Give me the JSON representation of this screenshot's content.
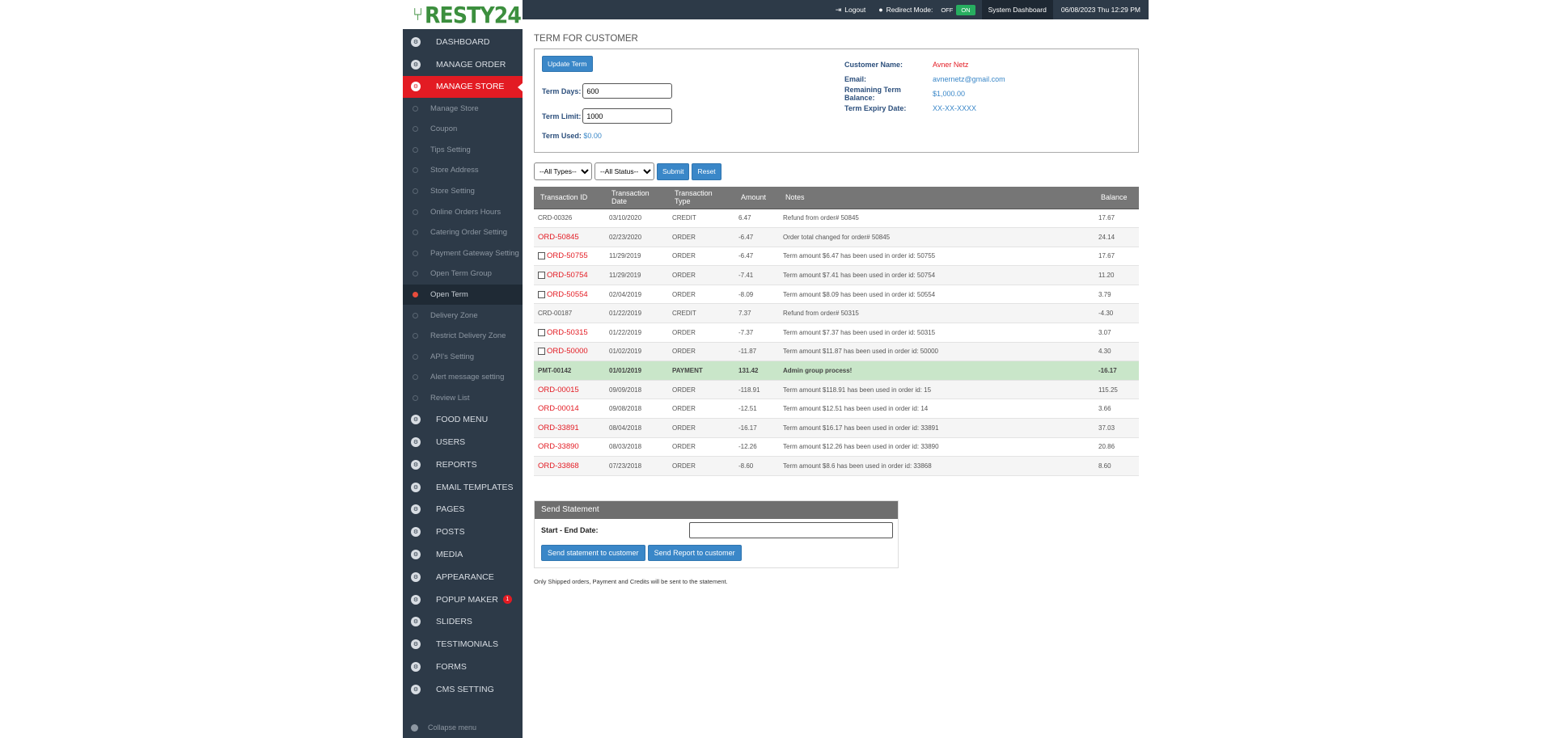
{
  "brand": {
    "name": "RESTY24"
  },
  "sidebar": {
    "main_items_top": [
      {
        "label": "DASHBOARD",
        "icon": "dashboard-icon"
      },
      {
        "label": "MANAGE ORDER",
        "icon": "gear-icon"
      },
      {
        "label": "MANAGE STORE",
        "icon": "gear-icon",
        "active": true
      }
    ],
    "sub_items": [
      {
        "label": "Manage Store"
      },
      {
        "label": "Coupon"
      },
      {
        "label": "Tips Setting"
      },
      {
        "label": "Store Address"
      },
      {
        "label": "Store Setting"
      },
      {
        "label": "Online Orders Hours"
      },
      {
        "label": "Catering Order Setting"
      },
      {
        "label": "Payment Gateway Setting"
      },
      {
        "label": "Open Term Group"
      },
      {
        "label": "Open Term",
        "active": true
      },
      {
        "label": "Delivery Zone"
      },
      {
        "label": "Restrict Delivery Zone"
      },
      {
        "label": "API's Setting"
      },
      {
        "label": "Alert message setting"
      },
      {
        "label": "Review List"
      }
    ],
    "main_items_bottom": [
      {
        "label": "FOOD MENU",
        "icon": "gear-icon"
      },
      {
        "label": "USERS",
        "icon": "user-icon"
      },
      {
        "label": "REPORTS",
        "icon": "gear-icon"
      },
      {
        "label": "EMAIL TEMPLATES",
        "icon": "gear-icon"
      },
      {
        "label": "PAGES",
        "icon": "page-icon"
      },
      {
        "label": "POSTS",
        "icon": "pin-icon"
      },
      {
        "label": "MEDIA",
        "icon": "media-icon"
      },
      {
        "label": "APPEARANCE",
        "icon": "brush-icon"
      },
      {
        "label": "POPUP MAKER",
        "icon": "popup-icon",
        "badge": "1"
      },
      {
        "label": "SLIDERS",
        "icon": "slider-icon"
      },
      {
        "label": "TESTIMONIALS",
        "icon": "quote-icon"
      },
      {
        "label": "FORMS",
        "icon": "form-icon"
      },
      {
        "label": "CMS SETTING",
        "icon": "gear-icon"
      }
    ],
    "collapse_label": "Collapse menu"
  },
  "topbar": {
    "logout_label": "Logout",
    "redirect_label": "Redirect Mode:",
    "switch_off": "OFF",
    "switch_on": "ON",
    "dashboard_label": "System Dashboard",
    "datetime": "06/08/2023 Thu 12:29 PM"
  },
  "page": {
    "title": "TERM FOR CUSTOMER",
    "update_button": "Update Term",
    "term_days_label": "Term Days:",
    "term_days_value": "600",
    "term_limit_label": "Term Limit:",
    "term_limit_value": "1000",
    "term_used_label": "Term Used:",
    "term_used_value": "$0.00"
  },
  "customer": {
    "name_label": "Customer Name:",
    "name": "Avner Netz",
    "email_label": "Email:",
    "email": "avnernetz@gmail.com",
    "balance_label": "Remaining Term Balance:",
    "balance": "$1,000.00",
    "expiry_label": "Term Expiry Date:",
    "expiry": "XX-XX-XXXX"
  },
  "filters": {
    "types": "--All Types--",
    "status": "--All Status--",
    "submit": "Submit",
    "reset": "Reset"
  },
  "table": {
    "headers": [
      "Transaction ID",
      "Transaction Date",
      "Transaction Type",
      "Amount",
      "Notes",
      "Balance"
    ],
    "rows": [
      {
        "id": "CRD-00326",
        "link": false,
        "check": false,
        "date": "03/10/2020",
        "type": "CREDIT",
        "amount": "6.47",
        "notes": "Refund from order# 50845",
        "balance": "17.67"
      },
      {
        "id": "ORD-50845",
        "link": true,
        "check": false,
        "date": "02/23/2020",
        "type": "ORDER",
        "amount": "-6.47",
        "notes": "Order total changed for order# 50845",
        "balance": "24.14"
      },
      {
        "id": "ORD-50755",
        "link": true,
        "check": true,
        "date": "11/29/2019",
        "type": "ORDER",
        "amount": "-6.47",
        "notes": "Term amount $6.47 has been used in order id: 50755",
        "balance": "17.67"
      },
      {
        "id": "ORD-50754",
        "link": true,
        "check": true,
        "date": "11/29/2019",
        "type": "ORDER",
        "amount": "-7.41",
        "notes": "Term amount $7.41 has been used in order id: 50754",
        "balance": "11.20"
      },
      {
        "id": "ORD-50554",
        "link": true,
        "check": true,
        "date": "02/04/2019",
        "type": "ORDER",
        "amount": "-8.09",
        "notes": "Term amount $8.09 has been used in order id: 50554",
        "balance": "3.79"
      },
      {
        "id": "CRD-00187",
        "link": false,
        "check": false,
        "date": "01/22/2019",
        "type": "CREDIT",
        "amount": "7.37",
        "notes": "Refund from order# 50315",
        "balance": "-4.30"
      },
      {
        "id": "ORD-50315",
        "link": true,
        "check": true,
        "date": "01/22/2019",
        "type": "ORDER",
        "amount": "-7.37",
        "notes": "Term amount $7.37 has been used in order id: 50315",
        "balance": "3.07"
      },
      {
        "id": "ORD-50000",
        "link": true,
        "check": true,
        "date": "01/02/2019",
        "type": "ORDER",
        "amount": "-11.87",
        "notes": "Term amount $11.87 has been used in order id: 50000",
        "balance": "4.30"
      },
      {
        "id": "PMT-00142",
        "link": false,
        "check": false,
        "payment": true,
        "date": "01/01/2019",
        "type": "PAYMENT",
        "amount": "131.42",
        "notes": "Admin group process!",
        "balance": "-16.17"
      },
      {
        "id": "ORD-00015",
        "link": true,
        "check": false,
        "date": "09/09/2018",
        "type": "ORDER",
        "amount": "-118.91",
        "notes": "Term amount $118.91 has been used in order id: 15",
        "balance": "115.25"
      },
      {
        "id": "ORD-00014",
        "link": true,
        "check": false,
        "date": "09/08/2018",
        "type": "ORDER",
        "amount": "-12.51",
        "notes": "Term amount $12.51 has been used in order id: 14",
        "balance": "3.66"
      },
      {
        "id": "ORD-33891",
        "link": true,
        "check": false,
        "date": "08/04/2018",
        "type": "ORDER",
        "amount": "-16.17",
        "notes": "Term amount $16.17 has been used in order id: 33891",
        "balance": "37.03"
      },
      {
        "id": "ORD-33890",
        "link": true,
        "check": false,
        "date": "08/03/2018",
        "type": "ORDER",
        "amount": "-12.26",
        "notes": "Term amount $12.26 has been used in order id: 33890",
        "balance": "20.86"
      },
      {
        "id": "ORD-33868",
        "link": true,
        "check": false,
        "date": "07/23/2018",
        "type": "ORDER",
        "amount": "-8.60",
        "notes": "Term amount $8.6 has been used in order id: 33868",
        "balance": "8.60"
      }
    ]
  },
  "statement": {
    "header": "Send Statement",
    "date_label": "Start - End Date:",
    "send_statement": "Send statement to customer",
    "send_report": "Send Report to customer",
    "note": "Only Shipped orders, Payment and Credits will be sent to the statement."
  }
}
